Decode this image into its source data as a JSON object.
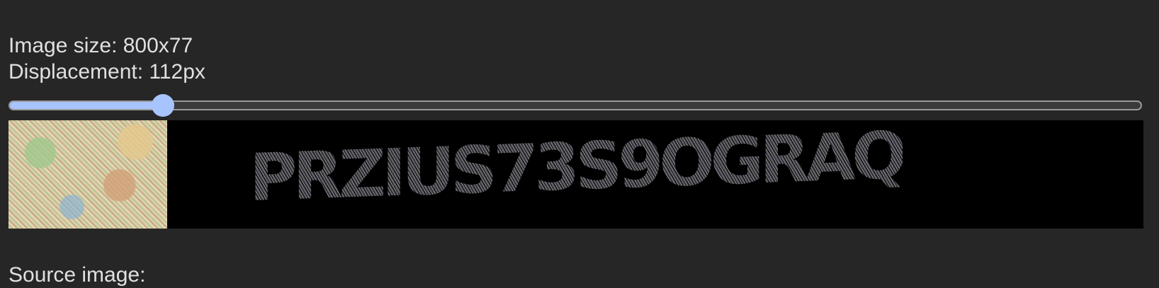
{
  "info": {
    "image_size": "Image size: 800x77",
    "displacement": "Displacement: 112px"
  },
  "slider": {
    "value": 112,
    "min": 0,
    "max": 800,
    "fill_color": "#a8c4ff"
  },
  "captcha": {
    "noisy_text": "PRZIUS73S9OGRAQ"
  },
  "source": {
    "label": "Source image:"
  }
}
